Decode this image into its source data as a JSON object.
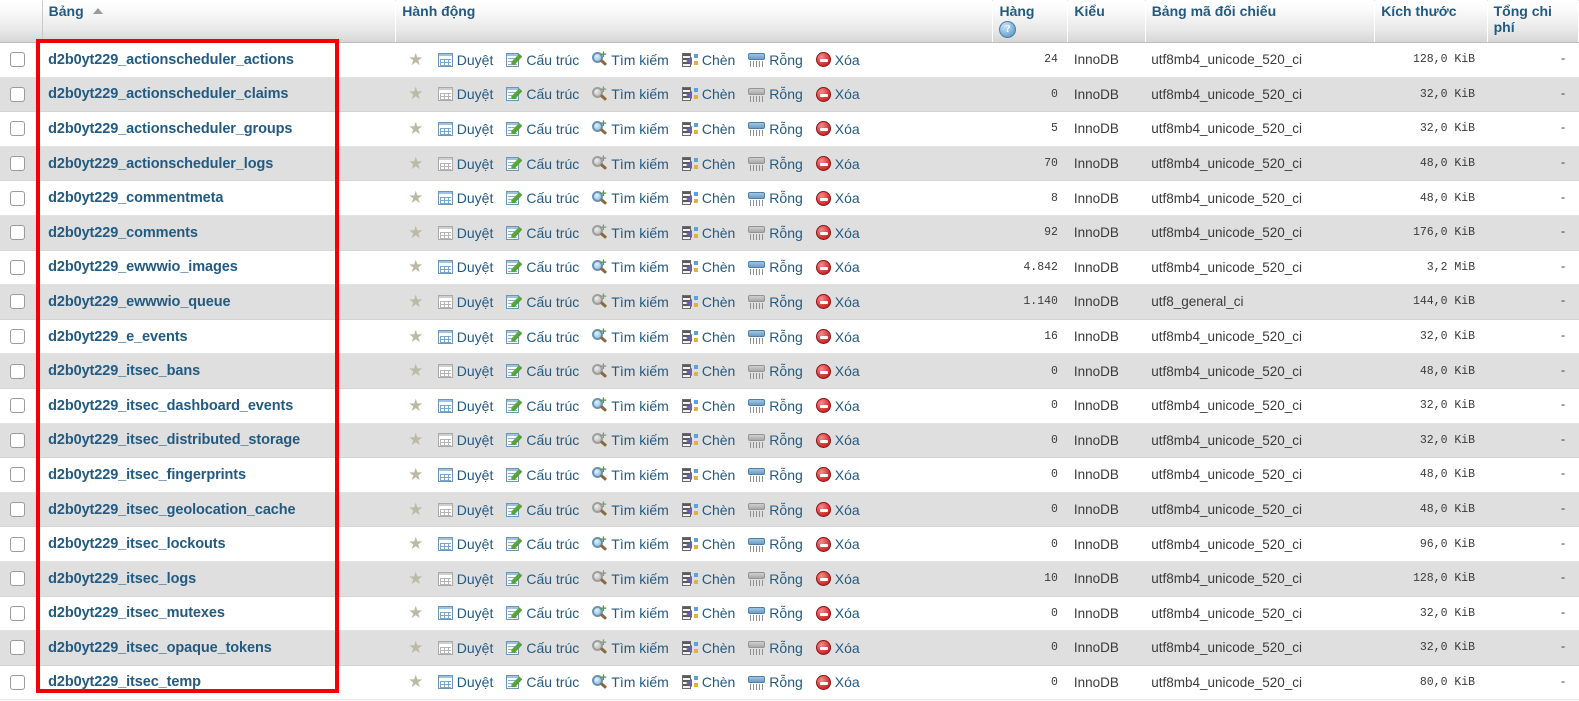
{
  "table_header": {
    "name": "Bảng",
    "action": "Hành động",
    "rows": "Hàng",
    "rows_help_icon": "help-question-icon",
    "type": "Kiểu",
    "collation": "Bảng mã đối chiếu",
    "size": "Kích thước",
    "overhead": "Tổng chi phí",
    "sort_indicator": "sort-asc-arrow"
  },
  "actions": [
    {
      "key": "favorite",
      "label": "",
      "icon": "star-icon"
    },
    {
      "key": "browse",
      "label": "Duyệt",
      "icon": "browse-table-icon"
    },
    {
      "key": "structure",
      "label": "Cấu trúc",
      "icon": "structure-pencil-icon"
    },
    {
      "key": "search",
      "label": "Tìm kiếm",
      "icon": "search-magnifier-icon"
    },
    {
      "key": "insert",
      "label": "Chèn",
      "icon": "insert-row-icon"
    },
    {
      "key": "empty",
      "label": "Rỗng",
      "icon": "empty-shredder-icon"
    },
    {
      "key": "drop",
      "label": "Xóa",
      "icon": "drop-delete-icon"
    }
  ],
  "colors": {
    "link": "#235a81",
    "highlight_box": "#f40000",
    "row_alt": "#dfdfdf",
    "row_base": "#ffffff"
  },
  "highlight": {
    "shape": "rectangle",
    "color": "#f40000",
    "covers": "table-name-column"
  },
  "rows": [
    {
      "name": "d2b0yt229_actionscheduler_actions",
      "rows": "24",
      "type": "InnoDB",
      "collation": "utf8mb4_unicode_520_ci",
      "size": "128,0 KiB",
      "overhead": "-"
    },
    {
      "name": "d2b0yt229_actionscheduler_claims",
      "rows": "0",
      "type": "InnoDB",
      "collation": "utf8mb4_unicode_520_ci",
      "size": "32,0 KiB",
      "overhead": "-"
    },
    {
      "name": "d2b0yt229_actionscheduler_groups",
      "rows": "5",
      "type": "InnoDB",
      "collation": "utf8mb4_unicode_520_ci",
      "size": "32,0 KiB",
      "overhead": "-"
    },
    {
      "name": "d2b0yt229_actionscheduler_logs",
      "rows": "70",
      "type": "InnoDB",
      "collation": "utf8mb4_unicode_520_ci",
      "size": "48,0 KiB",
      "overhead": "-"
    },
    {
      "name": "d2b0yt229_commentmeta",
      "rows": "8",
      "type": "InnoDB",
      "collation": "utf8mb4_unicode_520_ci",
      "size": "48,0 KiB",
      "overhead": "-"
    },
    {
      "name": "d2b0yt229_comments",
      "rows": "92",
      "type": "InnoDB",
      "collation": "utf8mb4_unicode_520_ci",
      "size": "176,0 KiB",
      "overhead": "-"
    },
    {
      "name": "d2b0yt229_ewwwio_images",
      "rows": "4.842",
      "type": "InnoDB",
      "collation": "utf8mb4_unicode_520_ci",
      "size": "3,2 MiB",
      "overhead": "-"
    },
    {
      "name": "d2b0yt229_ewwwio_queue",
      "rows": "1.140",
      "type": "InnoDB",
      "collation": "utf8_general_ci",
      "size": "144,0 KiB",
      "overhead": "-"
    },
    {
      "name": "d2b0yt229_e_events",
      "rows": "16",
      "type": "InnoDB",
      "collation": "utf8mb4_unicode_520_ci",
      "size": "32,0 KiB",
      "overhead": "-"
    },
    {
      "name": "d2b0yt229_itsec_bans",
      "rows": "0",
      "type": "InnoDB",
      "collation": "utf8mb4_unicode_520_ci",
      "size": "48,0 KiB",
      "overhead": "-"
    },
    {
      "name": "d2b0yt229_itsec_dashboard_events",
      "rows": "0",
      "type": "InnoDB",
      "collation": "utf8mb4_unicode_520_ci",
      "size": "32,0 KiB",
      "overhead": "-"
    },
    {
      "name": "d2b0yt229_itsec_distributed_storage",
      "rows": "0",
      "type": "InnoDB",
      "collation": "utf8mb4_unicode_520_ci",
      "size": "32,0 KiB",
      "overhead": "-"
    },
    {
      "name": "d2b0yt229_itsec_fingerprints",
      "rows": "0",
      "type": "InnoDB",
      "collation": "utf8mb4_unicode_520_ci",
      "size": "48,0 KiB",
      "overhead": "-"
    },
    {
      "name": "d2b0yt229_itsec_geolocation_cache",
      "rows": "0",
      "type": "InnoDB",
      "collation": "utf8mb4_unicode_520_ci",
      "size": "48,0 KiB",
      "overhead": "-"
    },
    {
      "name": "d2b0yt229_itsec_lockouts",
      "rows": "0",
      "type": "InnoDB",
      "collation": "utf8mb4_unicode_520_ci",
      "size": "96,0 KiB",
      "overhead": "-"
    },
    {
      "name": "d2b0yt229_itsec_logs",
      "rows": "10",
      "type": "InnoDB",
      "collation": "utf8mb4_unicode_520_ci",
      "size": "128,0 KiB",
      "overhead": "-"
    },
    {
      "name": "d2b0yt229_itsec_mutexes",
      "rows": "0",
      "type": "InnoDB",
      "collation": "utf8mb4_unicode_520_ci",
      "size": "32,0 KiB",
      "overhead": "-"
    },
    {
      "name": "d2b0yt229_itsec_opaque_tokens",
      "rows": "0",
      "type": "InnoDB",
      "collation": "utf8mb4_unicode_520_ci",
      "size": "32,0 KiB",
      "overhead": "-"
    },
    {
      "name": "d2b0yt229_itsec_temp",
      "rows": "0",
      "type": "InnoDB",
      "collation": "utf8mb4_unicode_520_ci",
      "size": "80,0 KiB",
      "overhead": "-"
    }
  ]
}
